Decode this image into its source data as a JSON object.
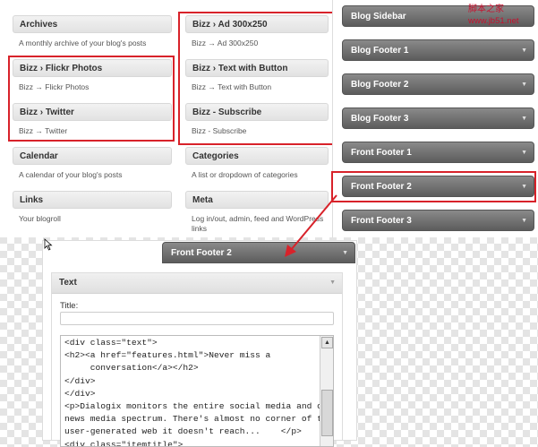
{
  "available_widgets": [
    {
      "title": "Archives",
      "desc": "A monthly archive of your blog's posts"
    },
    {
      "title": "Bizz   › Flickr Photos",
      "desc": "Bizz → Flickr Photos"
    },
    {
      "title": "Bizz   › Twitter",
      "desc": "Bizz → Twitter"
    },
    {
      "title": "Calendar",
      "desc": "A calendar of your blog's posts"
    },
    {
      "title": "Links",
      "desc": "Your blogroll"
    },
    {
      "title": "Bizz   › Ad 300x250",
      "desc": "Bizz → Ad 300x250"
    },
    {
      "title": "Bizz   › Text with Button",
      "desc": "Bizz → Text with Button"
    },
    {
      "title": "Bizz - Subscribe",
      "desc": "Bizz - Subscribe"
    },
    {
      "title": "Categories",
      "desc": "A list or dropdown of categories"
    },
    {
      "title": "Meta",
      "desc": "Log in/out, admin, feed and WordPress links"
    }
  ],
  "sidebars": [
    {
      "label": "Blog Sidebar"
    },
    {
      "label": "Blog Footer 1"
    },
    {
      "label": "Blog Footer 2"
    },
    {
      "label": "Blog Footer 3"
    },
    {
      "label": "Front Footer 1"
    },
    {
      "label": "Front Footer 2"
    },
    {
      "label": "Front Footer 3"
    }
  ],
  "watermark": {
    "line1": "脚本之家",
    "line2": "www.jb51.net"
  },
  "expanded": {
    "sidebar_title": "Front Footer 2",
    "widget_title": "Text",
    "title_label": "Title:",
    "title_value": "",
    "content": "<div class=\"text\">\n<h2><a href=\"features.html\">Never miss a\n     conversation</a></h2>\n</div>\n</div>\n<p>Dialogix monitors the entire social media and online\nnews media spectrum. There's almost no corner of the\nuser-generated web it doesn't reach...    </p>\n<div class=\"itemtitle\">"
  },
  "icons": {
    "collapse_arrow": "▼",
    "scroll_up": "▲"
  },
  "colors": {
    "highlight_red": "#d8222a"
  }
}
